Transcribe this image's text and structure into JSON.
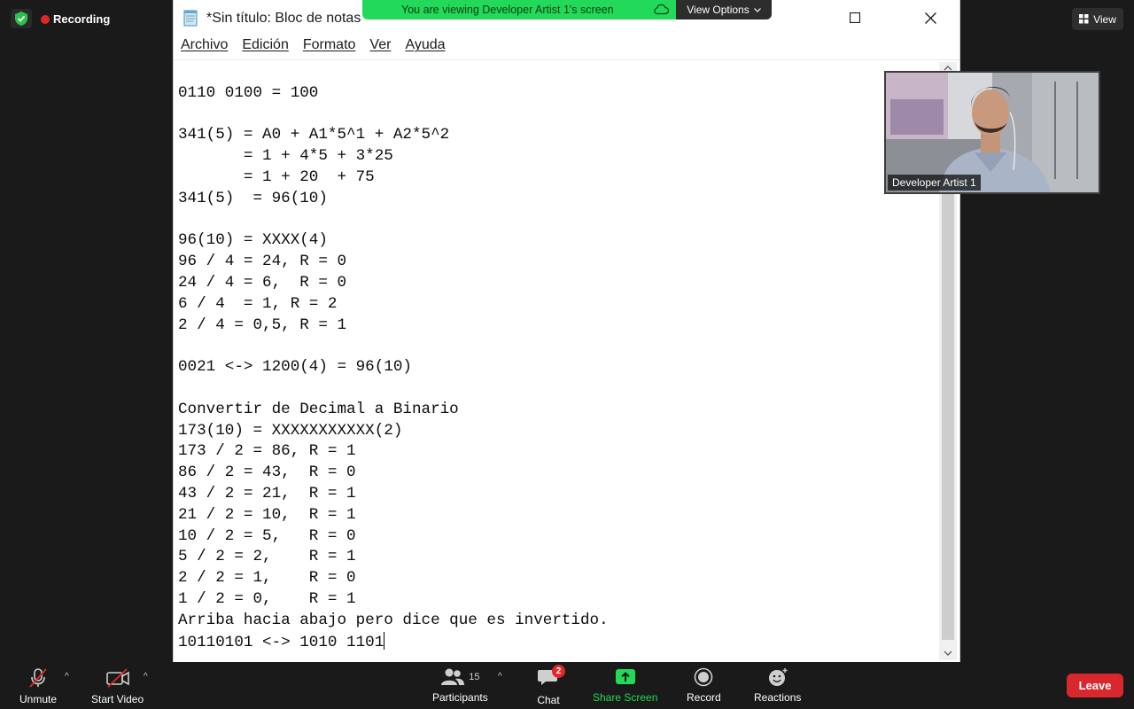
{
  "status": {
    "recording_label": "Recording"
  },
  "view_button": {
    "label": "View"
  },
  "banner": {
    "text": "You are viewing Developer Artist 1's screen",
    "options_label": "View Options"
  },
  "notepad": {
    "title": "*Sin título: Bloc de notas",
    "menu": [
      "Archivo",
      "Edición",
      "Formato",
      "Ver",
      "Ayuda"
    ],
    "lines": [
      "",
      "0110 0100 = 100",
      "",
      "341(5) = A0 + A1*5^1 + A2*5^2",
      "       = 1 + 4*5 + 3*25",
      "       = 1 + 20  + 75",
      "341(5)  = 96(10)",
      "",
      "96(10) = XXXX(4)",
      "96 / 4 = 24, R = 0",
      "24 / 4 = 6,  R = 0",
      "6 / 4  = 1, R = 2",
      "2 / 4 = 0,5, R = 1",
      "",
      "0021 <-> 1200(4) = 96(10)",
      "",
      "Convertir de Decimal a Binario",
      "173(10) = XXXXXXXXXXX(2)",
      "173 / 2 = 86, R = 1",
      "86 / 2 = 43,  R = 0",
      "43 / 2 = 21,  R = 1",
      "21 / 2 = 10,  R = 1",
      "10 / 2 = 5,   R = 0",
      "5 / 2 = 2,    R = 1",
      "2 / 2 = 1,    R = 0",
      "1 / 2 = 0,    R = 1",
      "Arriba hacia abajo pero dice que es invertido.",
      "10110101 <-> 1010 1101"
    ]
  },
  "video": {
    "participant_name": "Developer Artist 1"
  },
  "toolbar": {
    "unmute": "Unmute",
    "start_video": "Start Video",
    "participants": "Participants",
    "participants_count": "15",
    "chat": "Chat",
    "chat_badge": "2",
    "share_screen": "Share Screen",
    "record": "Record",
    "reactions": "Reactions",
    "leave": "Leave"
  },
  "colors": {
    "share_green": "#23d959",
    "leave_red": "#d9282d",
    "recording_red": "#e02828"
  }
}
